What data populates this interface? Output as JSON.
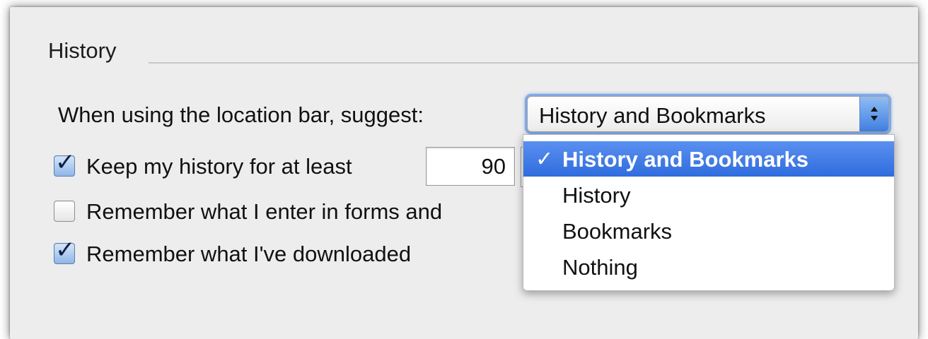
{
  "section": {
    "title": "History"
  },
  "suggest": {
    "label": "When using the location bar, suggest:",
    "selected": "History and Bookmarks",
    "menu": {
      "checkmark": "✓",
      "items": [
        "History and Bookmarks",
        "History",
        "Bookmarks",
        "Nothing"
      ]
    }
  },
  "keep_history": {
    "label": "Keep my history for at least",
    "checked": true,
    "days": "90"
  },
  "remember_forms": {
    "label": "Remember what I enter in forms and",
    "checked": false
  },
  "remember_downloads": {
    "label": "Remember what I've downloaded",
    "checked": true
  },
  "colors": {
    "accent": "#3f80e0",
    "menu_highlight": "#2f6cde",
    "panel_bg": "#ededed"
  }
}
